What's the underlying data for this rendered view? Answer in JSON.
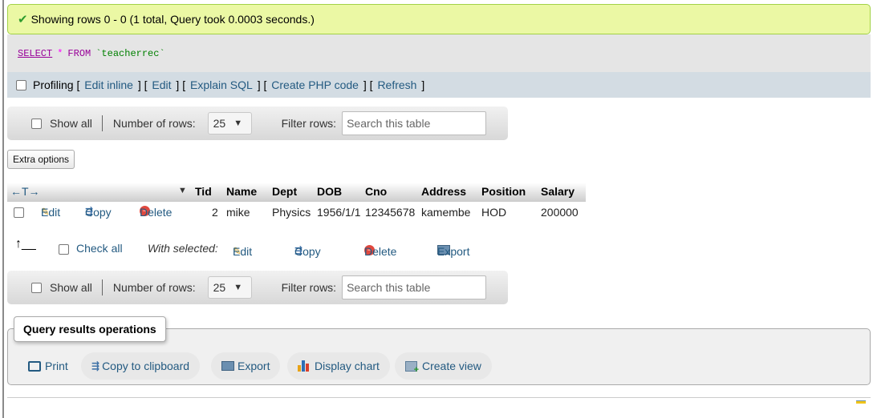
{
  "result_message": "Showing rows 0 - 0 (1 total, Query took 0.0003 seconds.)",
  "sql": {
    "select": "SELECT",
    "star": "*",
    "from": "FROM",
    "table": "`teacherrec`"
  },
  "tools": {
    "profiling": "Profiling",
    "edit_inline": "Edit inline",
    "edit": "Edit",
    "explain": "Explain SQL",
    "php": "Create PHP code",
    "refresh": "Refresh"
  },
  "nav": {
    "show_all": "Show all",
    "rows_label": "Number of rows:",
    "rows_value": "25",
    "filter_label": "Filter rows:",
    "search_placeholder": "Search this table"
  },
  "extra_options": "Extra options",
  "table": {
    "arrows": "←T→",
    "columns": [
      "Tid",
      "Name",
      "Dept",
      "DOB",
      "Cno",
      "Address",
      "Position",
      "Salary"
    ],
    "row_actions": {
      "edit": "Edit",
      "copy": "Copy",
      "delete": "Delete"
    },
    "rows": [
      {
        "Tid": "2",
        "Name": "mike",
        "Dept": "Physics",
        "DOB": "1956/1/1",
        "Cno": "12345678",
        "Address": "kamembe",
        "Position": "HOD",
        "Salary": "200000"
      }
    ]
  },
  "bulk": {
    "check_all": "Check all",
    "with_selected": "With selected:",
    "edit": "Edit",
    "copy": "Copy",
    "delete": "Delete",
    "export": "Export"
  },
  "query_ops": {
    "title": "Query results operations",
    "print": "Print",
    "copy_clipboard": "Copy to clipboard",
    "export": "Export",
    "display_chart": "Display chart",
    "create_view": "Create view"
  },
  "colors": {
    "success_bg": "#ebf8a4",
    "link": "#235a81",
    "tools_bg": "#d3dce3"
  }
}
